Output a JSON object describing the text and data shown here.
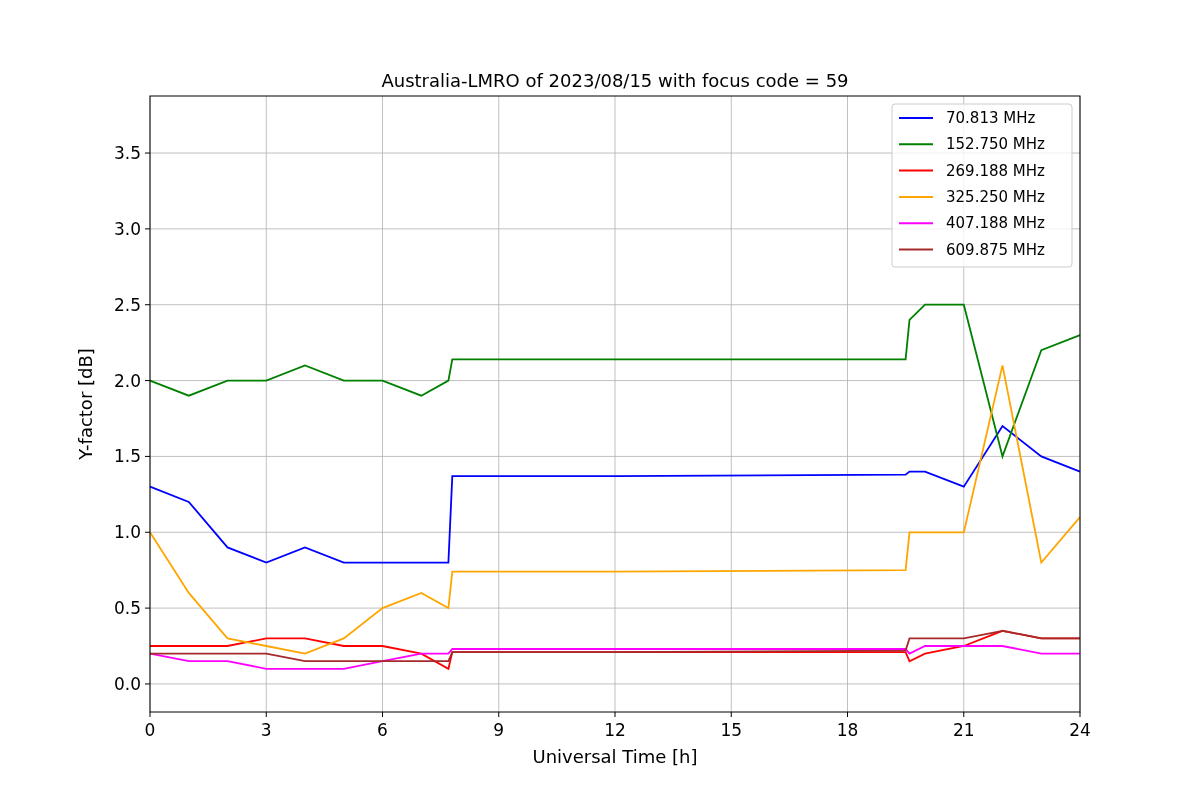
{
  "chart_data": {
    "type": "line",
    "title": "Australia-LMRO of 2023/08/15 with focus code = 59",
    "xlabel": "Universal Time [h]",
    "ylabel": "Y-factor [dB]",
    "x": [
      0,
      1,
      2,
      3,
      4,
      5,
      6,
      7,
      7.7,
      7.8,
      12,
      19.5,
      19.6,
      20,
      21,
      22,
      23,
      24
    ],
    "series": [
      {
        "name": "70.813 MHz",
        "color": "#0000ff",
        "values": [
          1.3,
          1.2,
          0.9,
          0.8,
          0.9,
          0.8,
          0.8,
          0.8,
          0.8,
          1.37,
          1.37,
          1.38,
          1.4,
          1.4,
          1.3,
          1.7,
          1.5,
          1.4
        ]
      },
      {
        "name": "152.750 MHz",
        "color": "#008000",
        "values": [
          2.0,
          1.9,
          2.0,
          2.0,
          2.1,
          2.0,
          2.0,
          1.9,
          2.0,
          2.14,
          2.14,
          2.14,
          2.4,
          2.5,
          2.5,
          1.5,
          2.2,
          2.3
        ]
      },
      {
        "name": "269.188 MHz",
        "color": "#ff0000",
        "values": [
          0.25,
          0.25,
          0.25,
          0.3,
          0.3,
          0.25,
          0.25,
          0.2,
          0.1,
          0.21,
          0.21,
          0.21,
          0.15,
          0.2,
          0.25,
          0.35,
          0.3,
          0.3
        ]
      },
      {
        "name": "325.250 MHz",
        "color": "#ffa500",
        "values": [
          1.0,
          0.6,
          0.3,
          0.25,
          0.2,
          0.3,
          0.5,
          0.6,
          0.5,
          0.74,
          0.74,
          0.75,
          1.0,
          1.0,
          1.0,
          2.1,
          0.8,
          1.1
        ]
      },
      {
        "name": "407.188 MHz",
        "color": "#ff00ff",
        "values": [
          0.2,
          0.15,
          0.15,
          0.1,
          0.1,
          0.1,
          0.15,
          0.2,
          0.2,
          0.23,
          0.23,
          0.23,
          0.2,
          0.25,
          0.25,
          0.25,
          0.2,
          0.2
        ]
      },
      {
        "name": "609.875 MHz",
        "color": "#a52a2a",
        "values": [
          0.2,
          0.2,
          0.2,
          0.2,
          0.15,
          0.15,
          0.15,
          0.15,
          0.15,
          0.21,
          0.21,
          0.22,
          0.3,
          0.3,
          0.3,
          0.35,
          0.3,
          0.3
        ]
      }
    ],
    "grid": true,
    "legend": true,
    "xlim": [
      0,
      24
    ],
    "ylim": [
      -0.185,
      3.876
    ],
    "xticks": [
      {
        "value": 0,
        "label": "0"
      },
      {
        "value": 3,
        "label": "3"
      },
      {
        "value": 6,
        "label": "6"
      },
      {
        "value": 9,
        "label": "9"
      },
      {
        "value": 12,
        "label": "12"
      },
      {
        "value": 15,
        "label": "15"
      },
      {
        "value": 18,
        "label": "18"
      },
      {
        "value": 21,
        "label": "21"
      },
      {
        "value": 24,
        "label": "24"
      }
    ],
    "yticks": [
      {
        "value": 0,
        "label": "0.0"
      },
      {
        "value": 0.5,
        "label": "0.5"
      },
      {
        "value": 1,
        "label": "1.0"
      },
      {
        "value": 1.5,
        "label": "1.5"
      },
      {
        "value": 2,
        "label": "2.0"
      },
      {
        "value": 2.5,
        "label": "2.5"
      },
      {
        "value": 3,
        "label": "3.0"
      },
      {
        "value": 3.5,
        "label": "3.5"
      }
    ]
  }
}
